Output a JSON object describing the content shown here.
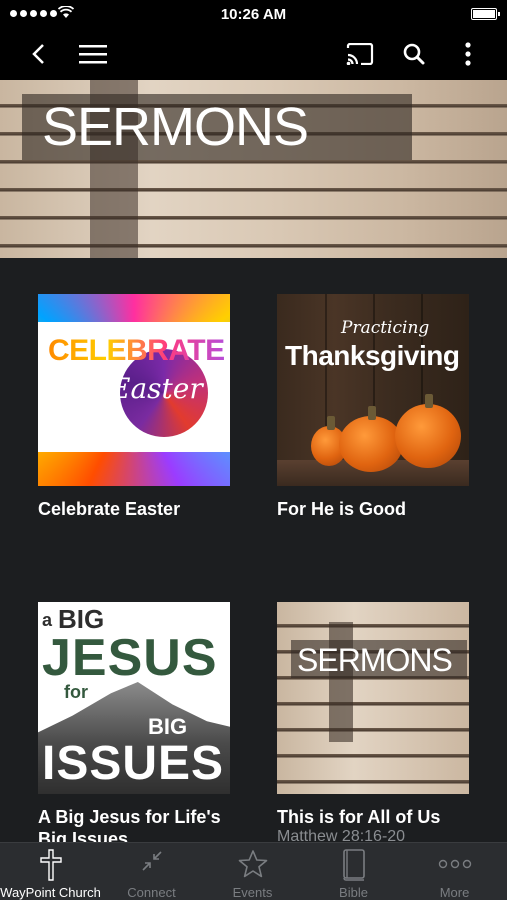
{
  "status_bar": {
    "time": "10:26 AM"
  },
  "nav": {
    "back": "back",
    "menu": "menu",
    "cast": "cast",
    "search": "search",
    "more": "more"
  },
  "hero": {
    "title": "SERMONS"
  },
  "series": [
    {
      "title": "Celebrate Easter",
      "subtitle": "",
      "art": {
        "word": "CELEBRATE",
        "script": "Easter"
      }
    },
    {
      "title": "For He is Good",
      "subtitle": "",
      "art": {
        "small": "Practicing",
        "big": "Thanksgiving"
      }
    },
    {
      "title": "A Big Jesus for Life's Big Issues",
      "subtitle": "",
      "art": {
        "a": "a",
        "big1": "BIG",
        "jesus": "JESUS",
        "for": "for",
        "big2": "BIG",
        "issues": "ISSUES"
      }
    },
    {
      "title": "This is for All of Us",
      "subtitle": "Matthew 28:16-20",
      "art": {
        "word": "SERMONS"
      }
    }
  ],
  "tab_bar": {
    "tabs": [
      {
        "label": "WayPoint Church",
        "icon": "cross-icon",
        "active": true
      },
      {
        "label": "Connect",
        "icon": "connect-icon",
        "active": false
      },
      {
        "label": "Events",
        "icon": "star-icon",
        "active": false
      },
      {
        "label": "Bible",
        "icon": "book-icon",
        "active": false
      },
      {
        "label": "More",
        "icon": "ellipsis-icon",
        "active": false
      }
    ]
  }
}
